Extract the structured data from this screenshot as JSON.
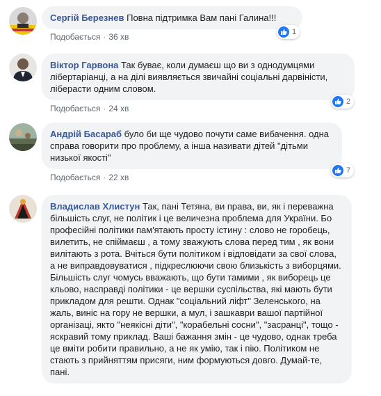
{
  "ui": {
    "like_label": "Подобається",
    "separator": "·"
  },
  "comments": [
    {
      "author": "Сергій Березнев",
      "text": "Повна підтримка Вам пані Галина!!!",
      "time": "36 хв",
      "likes": "1"
    },
    {
      "author": "Віктор Гарвона",
      "text": "Так буває, коли думаєш що ви з однодумцями лібертаріанці, а на ділі виявляється звичайні соціальні дарвіністи, ліберасти одним словом.",
      "time": "24 хв",
      "likes": "2"
    },
    {
      "author": "Андрій Басараб",
      "text": "було би ще чудово почути саме вибачення. одна справа говорити про проблему, а інша називати дітей \"дітьми низької якості\"",
      "time": "22 хв",
      "likes": "7"
    },
    {
      "author": "Владислав Хлистун",
      "text": "Так, пані Тетяна, ви права, ви, як і переважна більшість слуг, не політик і це величезна проблема для України. Бо професійні політики пам'ятають просту істину : слово не горобець, вилетить, не спіймаєш , а тому зважують слова перед тим , як вони вилітають з рота. Вчіться бути політиком і відповідати за свої слова, а не виправдовуватися , підкреслюючи свою близькість з виборцями. Більшість слуг чомусь вважають, що бути тамими , як виборець це кльово, насправді політики - це вершки суспільства, які мають бути прикладом для решти. Однак \"соціальний ліфт\" Зеленського, на жаль, виніс на гору не вершки, а мул, і зашкаври вашої партійної організаці, якто \"неякісні діти\", \"корабельні сосни\", \"засранці\", тощо - яскравий тому приклад. Ваші бажання змін - це чудово, однак треба це вміти робити правильно, а не як умію, так і пію. Політиком не стають з прийняттям присяги, ним формуються довго. Думай-те, пані.",
      "likes": ""
    }
  ],
  "colors": {
    "author": "#385898",
    "bubble": "#f2f3f5",
    "like": "#2078f4",
    "meta": "#90949c"
  }
}
